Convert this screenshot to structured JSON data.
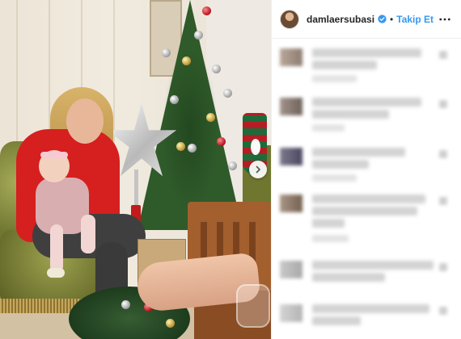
{
  "post": {
    "username": "damlaersubasi",
    "separator": "•",
    "follow_label": "Takip Et",
    "verified": true,
    "accent_color": "#3897f0"
  },
  "photo": {
    "has_next": true
  },
  "comments": {
    "count_visible": 6,
    "content_blurred": true
  },
  "icons": {
    "verified": "verified-badge-icon",
    "more": "more-options-icon",
    "next": "chevron-right-icon"
  }
}
